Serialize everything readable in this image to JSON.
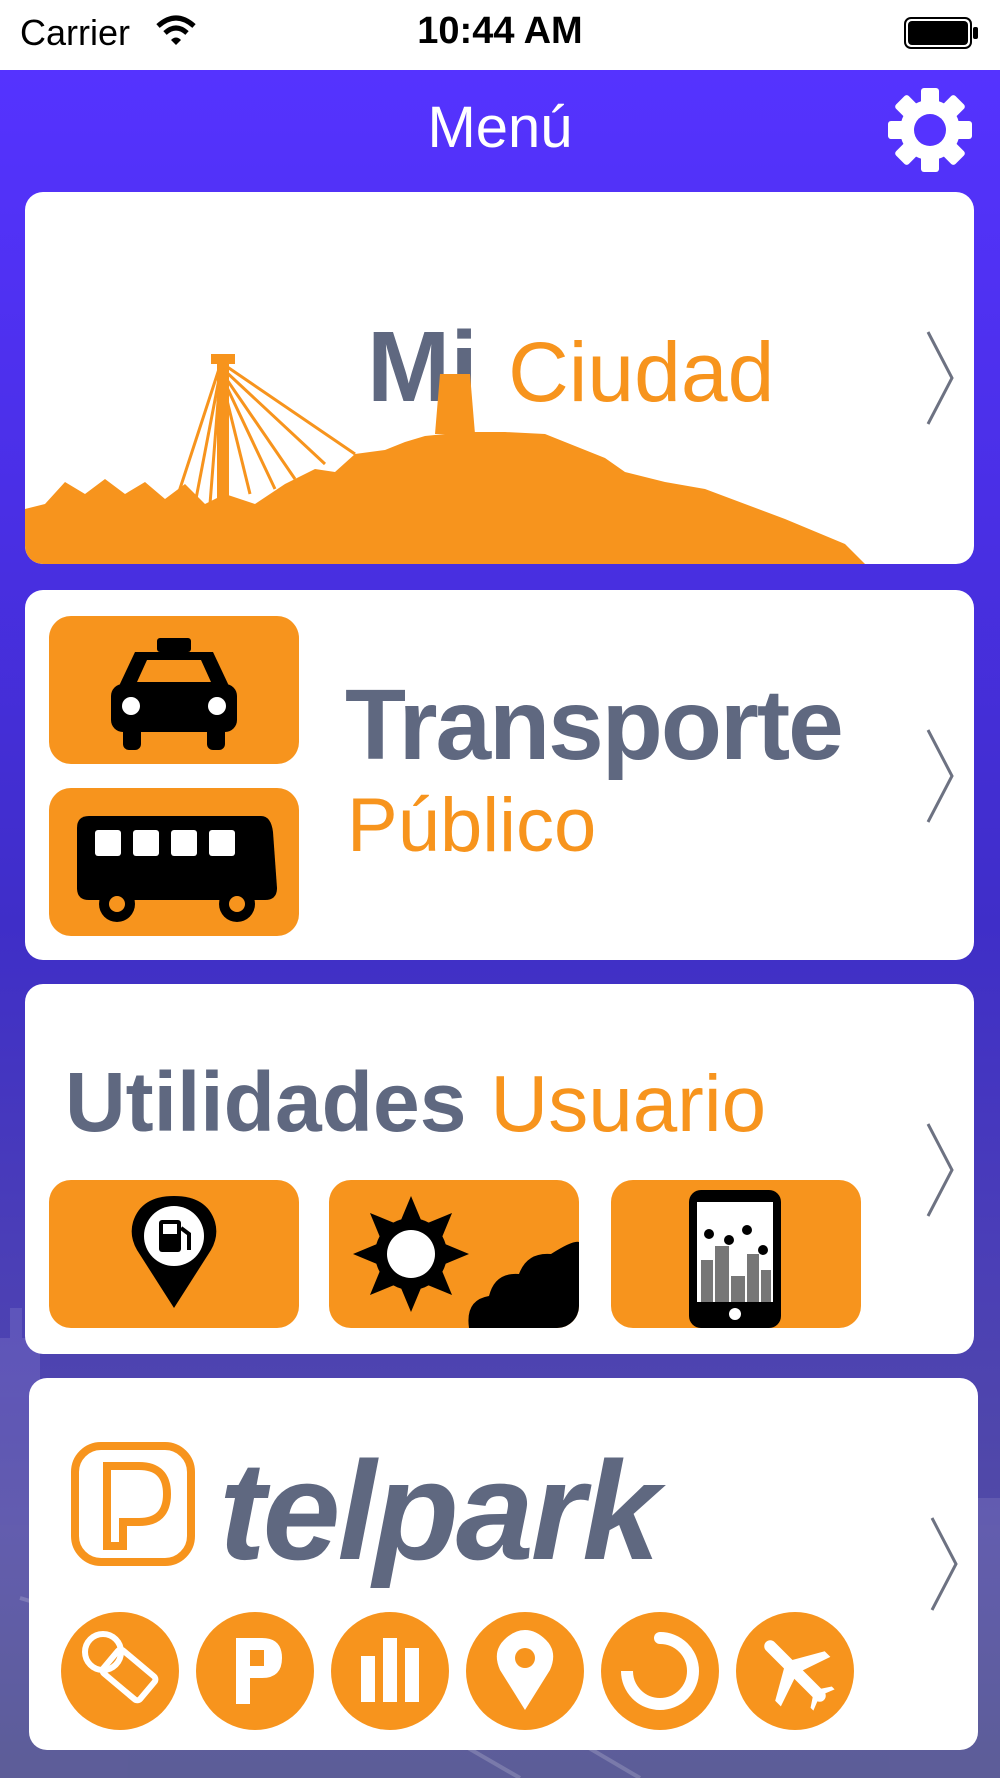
{
  "status_bar": {
    "carrier": "Carrier",
    "time": "10:44 AM",
    "icons": [
      "wifi-icon",
      "battery-icon"
    ]
  },
  "nav": {
    "title": "Menú",
    "settings_icon": "gear-icon"
  },
  "cards": {
    "city": {
      "word1": "Mi",
      "word2": "Ciudad",
      "icon": "chevron-right-icon"
    },
    "transport": {
      "word1": "Transporte",
      "word2": "Público",
      "tiles": [
        "taxi-icon",
        "bus-icon"
      ]
    },
    "utils": {
      "word1": "Utilidades",
      "word2": "Usuario",
      "tiles": [
        "gas-station-pin-icon",
        "weather-icon",
        "city-map-phone-icon"
      ]
    },
    "telpark": {
      "logo_text": "telpark",
      "buttons": [
        "payment-ticket-icon",
        "parking-icon",
        "stats-icon",
        "location-pin-icon",
        "timer-icon",
        "airplane-icon"
      ]
    }
  },
  "colors": {
    "accent_orange": "#f7941d",
    "text_slate": "#5f6880",
    "nav_purple": "#5533ff"
  }
}
